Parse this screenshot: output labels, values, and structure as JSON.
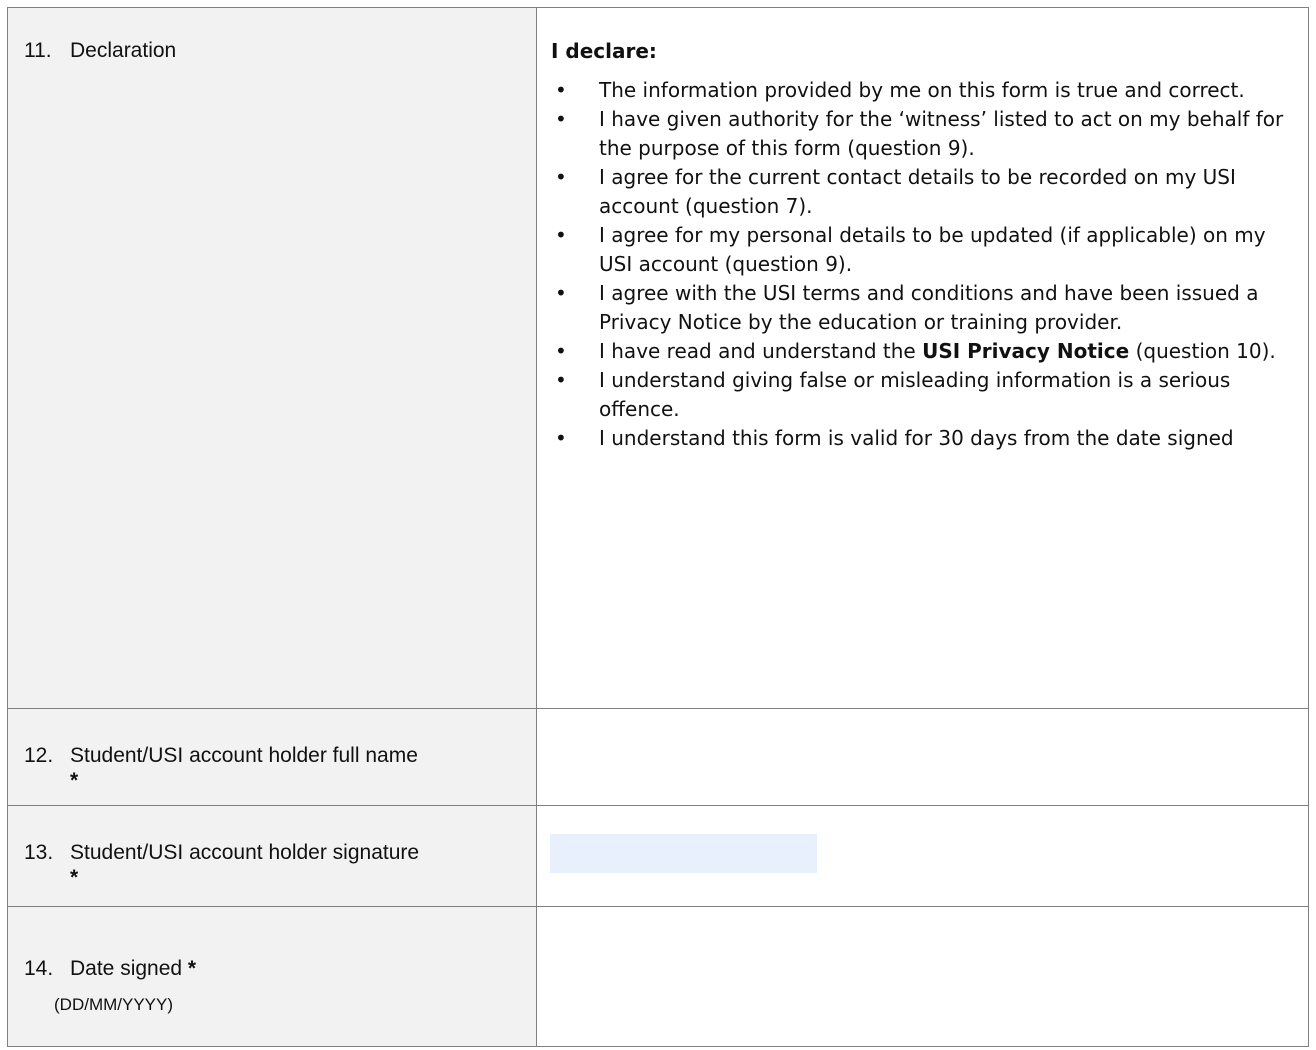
{
  "rows": {
    "declaration": {
      "number": "11.",
      "label": "Declaration",
      "heading": "I declare:",
      "items": [
        {
          "text": "The information provided by me on this form is true and correct."
        },
        {
          "text": "I have given authority for the ‘witness’ listed to act on my behalf for the purpose of this form (question 9)."
        },
        {
          "text": "I agree for the current contact details to be recorded on my USI account (question 7)."
        },
        {
          "text": "I agree for my personal details to be updated (if applicable) on my USI account (question 9)."
        },
        {
          "text": "I agree with the USI terms and conditions and have been issued a Privacy Notice by the education or training provider."
        },
        {
          "before": "I have read and understand the ",
          "bold": "USI Privacy Notice",
          "after": " (question 10)."
        },
        {
          "text": "I understand giving false or misleading information is a serious offence."
        },
        {
          "text": "I understand this form is valid for 30 days from the date signed"
        }
      ],
      "bullet": "•"
    },
    "full_name": {
      "number": "12.",
      "label": "Student/USI account holder full name",
      "required_mark": "*",
      "value": ""
    },
    "signature": {
      "number": "13.",
      "label": "Student/USI account holder signature",
      "required_mark": "*",
      "field_color": "#e8f0fd"
    },
    "date_signed": {
      "number": "14.",
      "label": "Date signed",
      "required_mark": "*",
      "format_hint": "(DD/MM/YYYY)",
      "value": ""
    }
  },
  "colors": {
    "label_background": "#f2f2f2",
    "border": "#808080"
  }
}
